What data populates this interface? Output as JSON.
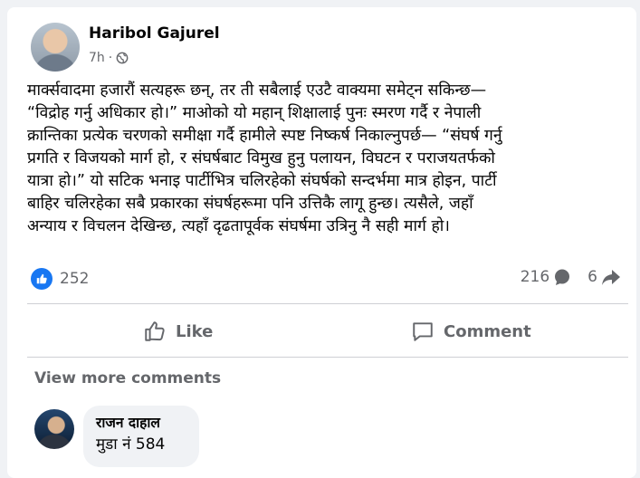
{
  "post": {
    "author": "Haribol Gajurel",
    "time": "7h",
    "separator": "·",
    "text": "मार्क्सवादमा हजारौं सत्यहरू छन्, तर ती सबैलाई एउटै वाक्यमा समेट्न सकिन्छ—\n“विद्रोह गर्नु अधिकार हो।” माओको यो महान् शिक्षालाई पुनः स्मरण गर्दै र नेपाली\nक्रान्तिका प्रत्येक चरणको समीक्षा गर्दै हामीले स्पष्ट निष्कर्ष निकाल्नुपर्छ— “संघर्ष गर्नु\nप्रगति र विजयको मार्ग हो, र संघर्षबाट विमुख हुनु पलायन, विघटन र पराजयतर्फको\nयात्रा हो।” यो सटिक भनाइ पार्टीभित्र चलिरहेको संघर्षको सन्दर्भमा मात्र होइन, पार्टी\nबाहिर चलिरहेका सबै प्रकारका संघर्षहरूमा पनि उत्तिकै लागू हुन्छ। त्यसैले, जहाँ\nअन्याय र विचलन देखिन्छ, त्यहाँ दृढतापूर्वक संघर्षमा उत्रिनु नै सही मार्ग हो।"
  },
  "stats": {
    "reactions": "252",
    "comments": "216",
    "shares": "6"
  },
  "actions": {
    "like_label": "Like",
    "comment_label": "Comment"
  },
  "comments_section": {
    "view_more_label": "View more comments",
    "comment": {
      "author": "राजन दाहाल",
      "text": "मुडा नं 584"
    }
  }
}
